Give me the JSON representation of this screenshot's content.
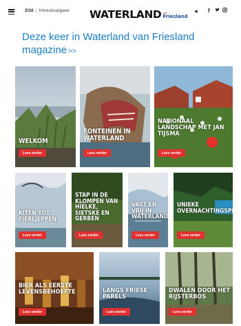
{
  "header": {
    "page_number": "2/16",
    "section": "Inhoudsopgave",
    "logo_main": "WATERLAND",
    "logo_van": "van",
    "logo_fries": "Friesland",
    "share_icon": "share-icon",
    "social_icons": [
      "facebook-icon",
      "twitter-icon",
      "instagram-icon"
    ]
  },
  "headline": {
    "line1": "Deze keer in Waterland van Friesland",
    "line2": "magazine",
    "arrows": ">>"
  },
  "cta_label": "Lees verder",
  "colors": {
    "accent_blue": "#1c7ec4",
    "button_red": "#e03030",
    "logo_blue": "#1c4f9c"
  },
  "articles": [
    {
      "title": "Welkom"
    },
    {
      "title": "Fonteinen in Waterland"
    },
    {
      "title": "Nationaal landschap met Jan Tijsma"
    },
    {
      "title": "Kiten tot fierljeppen"
    },
    {
      "title": "Stap in de klompen van Hielke, Sietske en Gerben"
    },
    {
      "title": "Vast en vrij in Waterland"
    },
    {
      "title": "Unieke overnachtingsplekken"
    },
    {
      "title": "Bier als eerste levensbehoefte"
    },
    {
      "title": "Langs Friese parels"
    },
    {
      "title": "Dwalen door het Rijsterbos"
    }
  ]
}
